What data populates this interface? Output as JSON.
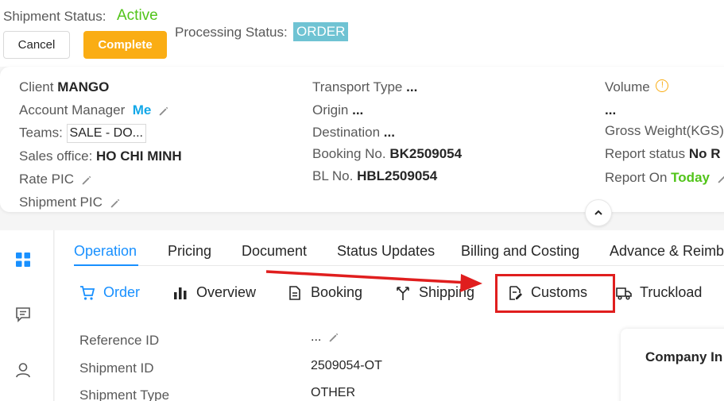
{
  "header": {
    "shipment_status_label": "Shipment Status:",
    "shipment_status_value": "Active",
    "cancel_label": "Cancel",
    "complete_label": "Complete",
    "processing_status_label": "Processing Status:",
    "processing_status_value": "ORDER"
  },
  "info": {
    "client_label": "Client",
    "client_value": "MANGO",
    "account_manager_label": "Account Manager",
    "account_manager_value": "Me",
    "teams_label": "Teams:",
    "teams_value": "SALE - DO...",
    "sales_office_label": "Sales office:",
    "sales_office_value": "HO CHI MINH",
    "rate_pic_label": "Rate PIC",
    "shipment_pic_label": "Shipment PIC",
    "transport_type_label": "Transport Type",
    "transport_type_value": "...",
    "origin_label": "Origin",
    "origin_value": "...",
    "destination_label": "Destination",
    "destination_value": "...",
    "booking_no_label": "Booking No.",
    "booking_no_value": "BK2509054",
    "bl_no_label": "BL No.",
    "bl_no_value": "HBL2509054",
    "volume_label": "Volume",
    "volume_value": "...",
    "gross_weight_label": "Gross Weight(KGS)",
    "report_status_label": "Report status",
    "report_status_value": "No R",
    "report_on_label": "Report On",
    "report_on_value": "Today"
  },
  "tabs": {
    "operation": "Operation",
    "pricing": "Pricing",
    "document": "Document",
    "status_updates": "Status Updates",
    "billing": "Billing and Costing",
    "advance": "Advance & Reimbu"
  },
  "subtabs": {
    "order": "Order",
    "overview": "Overview",
    "booking": "Booking",
    "shipping": "Shipping",
    "customs": "Customs",
    "truckload": "Truckload"
  },
  "details": {
    "reference_id_label": "Reference ID",
    "reference_id_value": "...",
    "shipment_id_label": "Shipment ID",
    "shipment_id_value": "2509054-OT",
    "shipment_type_label": "Shipment Type",
    "shipment_type_value": "OTHER"
  },
  "company_card": {
    "title": "Company In"
  },
  "colors": {
    "active_green": "#52c41a",
    "primary_blue": "#1890ff",
    "complete_orange": "#faad14",
    "order_badge": "#6fc3d3",
    "annotation_red": "#e01e1e"
  }
}
